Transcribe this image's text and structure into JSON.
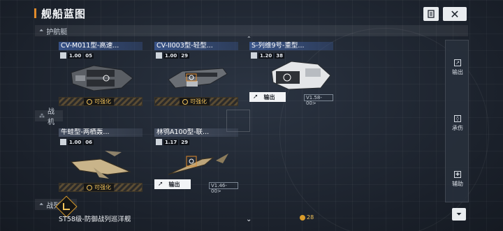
{
  "header": {
    "title": "舰船蓝图",
    "doc_icon": "document-icon",
    "close_icon": "close-icon",
    "close_glyph": "✕"
  },
  "sections": {
    "escort": "护航艇",
    "fighter": "战机",
    "battle": "战列舰"
  },
  "cards": [
    {
      "name": "CV-M011型-高速...",
      "version": "1.00",
      "level": "05",
      "status": "可强化"
    },
    {
      "name": "CV-II003型-轻型...",
      "version": "1.00",
      "level": "29",
      "status": "可强化"
    },
    {
      "name": "S-列维9号-重型...",
      "version": "1.20",
      "level": "38",
      "action": "输出",
      "build": "V1.58-00>"
    },
    {
      "name": "牛蛙型-两栖轰...",
      "version": "1.00",
      "level": "06",
      "status": "可强化"
    },
    {
      "name": "林鸮A100型-联...",
      "version": "1.17",
      "level": "29",
      "action": "输出",
      "build": "V1.46-00>"
    }
  ],
  "right_panel": {
    "items": [
      {
        "label": "输出",
        "icon": "arrow-out-icon"
      },
      {
        "label": "承伤",
        "icon": "shield-icon"
      },
      {
        "label": "辅助",
        "icon": "support-icon"
      }
    ],
    "filter_icon": "filter-icon"
  },
  "bottom": {
    "ship_name": "ST58级-防御战列巡洋舰",
    "gold_count": "28"
  },
  "colors": {
    "accent": "#e08a2a",
    "enhance": "#f0c25a",
    "name_bar": "#3c5a96"
  }
}
